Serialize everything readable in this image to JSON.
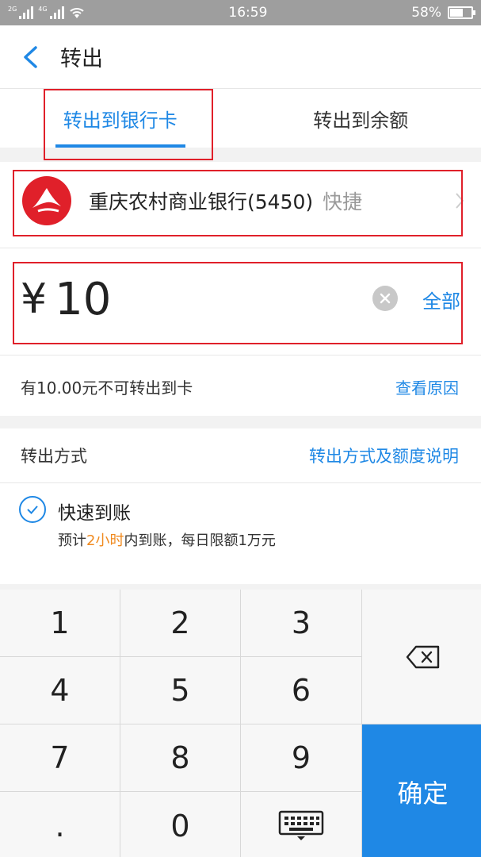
{
  "status_bar": {
    "time": "16:59",
    "battery": "58%",
    "battery_level": 0.58,
    "signal_tag_1": "2G",
    "signal_tag_2": "4G"
  },
  "header": {
    "title": "转出",
    "back_icon": "chevron-left-icon"
  },
  "tabs": [
    {
      "label": "转出到银行卡",
      "active": true
    },
    {
      "label": "转出到余额",
      "active": false
    }
  ],
  "bank": {
    "name": "重庆农村商业银行(5450)",
    "tag": "快捷"
  },
  "amount": {
    "currency": "¥",
    "value": "10",
    "all_label": "全部"
  },
  "notice": {
    "text": "有10.00元不可转出到卡",
    "link": "查看原因"
  },
  "method": {
    "label": "转出方式",
    "link": "转出方式及额度说明",
    "option_title": "快速到账",
    "desc_prefix": "预计",
    "desc_highlight": "2小时",
    "desc_suffix": "内到账，每日限额1万元"
  },
  "keypad": {
    "keys": [
      "1",
      "2",
      "3",
      "4",
      "5",
      "6",
      "7",
      "8",
      "9",
      ".",
      "0"
    ],
    "confirm": "确定"
  },
  "colors": {
    "accent": "#1f88e5",
    "highlight": "#f08a1f",
    "annotation_box": "#e0202a",
    "bank_logo": "#e0202a"
  }
}
